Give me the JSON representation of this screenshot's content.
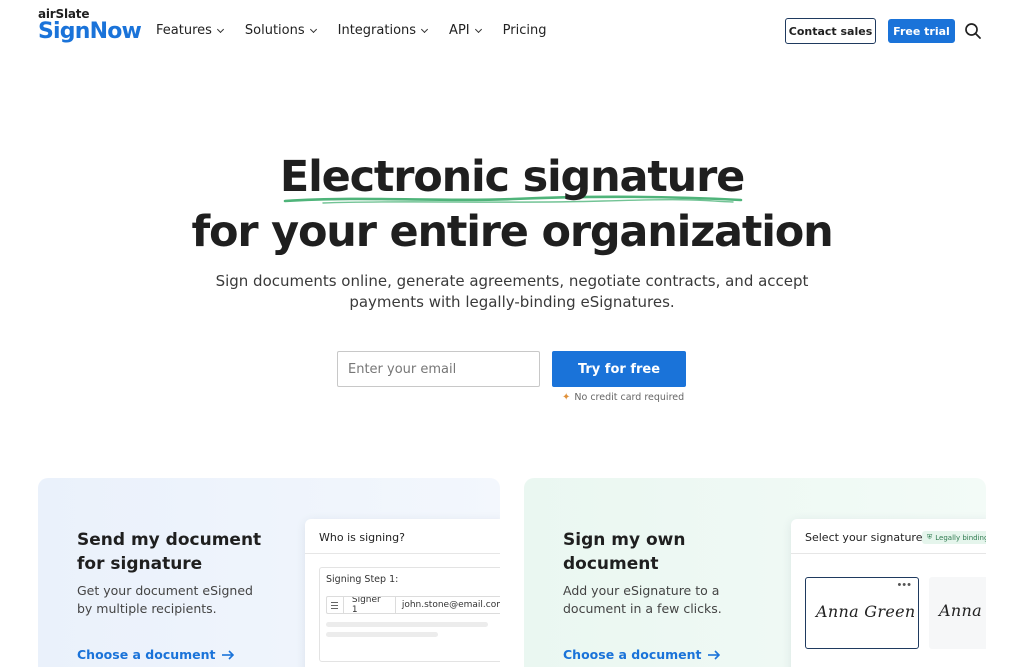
{
  "nav": {
    "logo_top": "airSlate",
    "logo_main": "SignNow",
    "menu": [
      {
        "label": "Features",
        "has_dropdown": true
      },
      {
        "label": "Solutions",
        "has_dropdown": true
      },
      {
        "label": "Integrations",
        "has_dropdown": true
      },
      {
        "label": "API",
        "has_dropdown": true
      },
      {
        "label": "Pricing",
        "has_dropdown": false
      }
    ],
    "contact_label": "Contact sales",
    "trial_label": "Free trial",
    "search_icon": "search-icon"
  },
  "hero": {
    "title_line1": "Electronic signature",
    "title_line2": "for your entire organization",
    "subtitle_line1": "Sign documents online, generate agreements, negotiate contracts, and accept",
    "subtitle_line2": "payments with legally-binding eSignatures.",
    "email_placeholder": "Enter your email",
    "cta_label": "Try for free",
    "note": "No credit card required",
    "underline_color": "#4fb47a"
  },
  "cards": {
    "send": {
      "title": "Send my document for signature",
      "description": "Get your document eSigned by multiple recipients.",
      "link": "Choose a document",
      "mock": {
        "heading": "Who is signing?",
        "step_label": "Signing Step 1:",
        "signer": "Signer 1",
        "email": "john.stone@email.com"
      }
    },
    "sign": {
      "title": "Sign my own document",
      "description": "Add your eSignature to a document in a few clicks.",
      "link": "Choose a document",
      "mock": {
        "heading": "Select your signature",
        "badge": "Legally binding",
        "signature1": "Anna Green",
        "signature2": "Anna G"
      }
    }
  },
  "colors": {
    "brand_blue": "#1a73d9",
    "text_dark": "#1f1f1f",
    "card_blue_bg": "#eaf1fb",
    "card_green_bg": "#eaf7f1"
  }
}
